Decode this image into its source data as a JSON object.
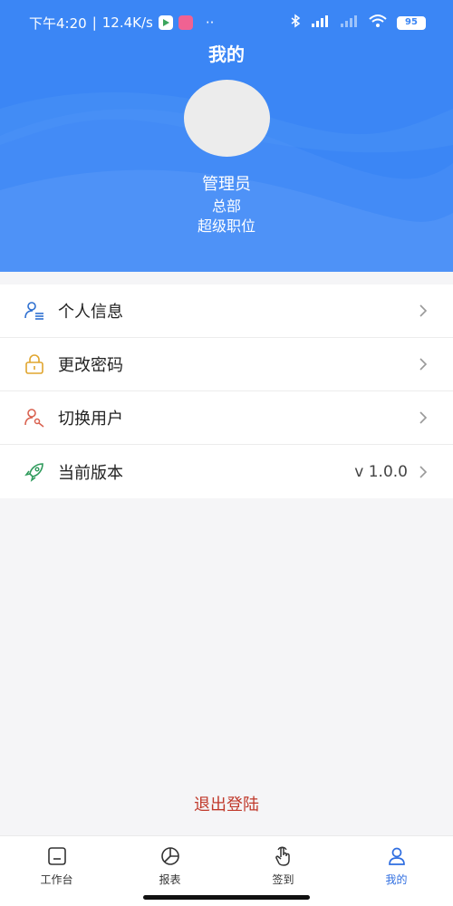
{
  "status_bar": {
    "time": "下午4:20",
    "network_speed": "12.4K/s",
    "battery": "95"
  },
  "header": {
    "title": "我的"
  },
  "profile": {
    "name": "管理员",
    "department": "总部",
    "role": "超级职位"
  },
  "menu": [
    {
      "label": "个人信息",
      "icon": "user-info-icon"
    },
    {
      "label": "更改密码",
      "icon": "lock-icon"
    },
    {
      "label": "切换用户",
      "icon": "user-key-icon"
    },
    {
      "label": "当前版本",
      "icon": "rocket-icon",
      "value": "v 1.0.0"
    }
  ],
  "logout_label": "退出登陆",
  "tabbar": [
    {
      "label": "工作台",
      "icon": "workbench-icon",
      "active": false
    },
    {
      "label": "报表",
      "icon": "pie-chart-icon",
      "active": false
    },
    {
      "label": "签到",
      "icon": "tap-hand-icon",
      "active": false
    },
    {
      "label": "我的",
      "icon": "user-icon",
      "active": true
    }
  ],
  "colors": {
    "header_bg": "#3b86f5",
    "logout": "#c0392b",
    "tab_active": "#2f6ee0"
  }
}
